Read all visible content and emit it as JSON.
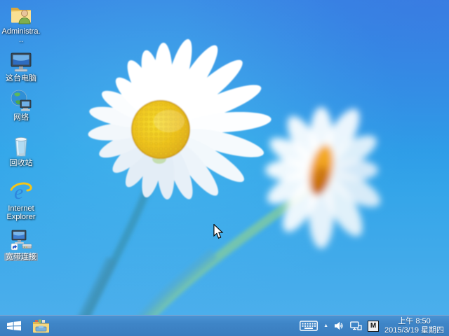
{
  "desktop": {
    "icons": [
      {
        "id": "administrator",
        "label": "Administra..."
      },
      {
        "id": "this-pc",
        "label": "这台电脑"
      },
      {
        "id": "network",
        "label": "网络"
      },
      {
        "id": "recycle-bin",
        "label": "回收站"
      },
      {
        "id": "internet-explorer",
        "label": "Internet Explorer"
      },
      {
        "id": "broadband",
        "label": "宽带连接"
      }
    ]
  },
  "taskbar": {
    "tray": {
      "show_hidden_glyph": "▲",
      "input_indicator": "M",
      "time": "上午 8:50",
      "date": "2015/3/19 星期四"
    }
  },
  "colors": {
    "taskbar_blue": "#3f86c8",
    "sky_top": "#3787e4",
    "sky_center": "#2da2e8",
    "sky_bottom": "#4fb0ec",
    "daisy_disc": "#eec31d",
    "second_disc_orange": "#ef9c1e"
  }
}
